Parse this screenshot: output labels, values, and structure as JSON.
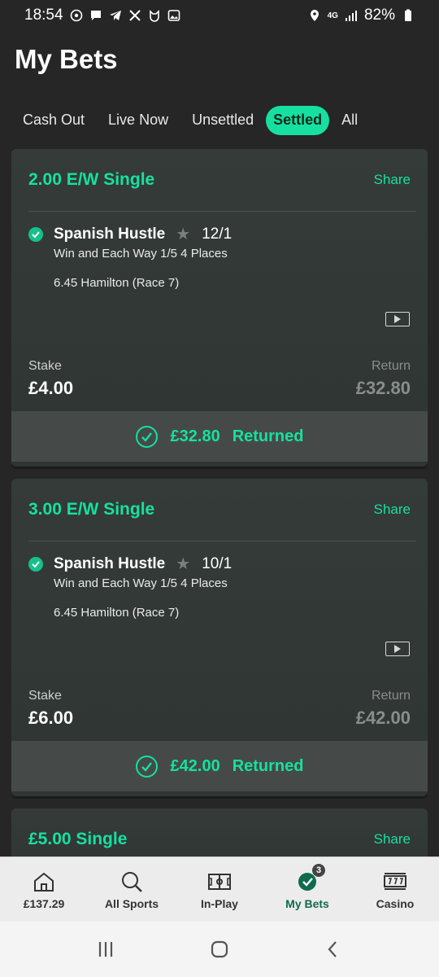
{
  "status_bar": {
    "time": "18:54",
    "network": "4G",
    "battery": "82%"
  },
  "page_title": "My Bets",
  "tabs": [
    {
      "label": "Cash Out",
      "active": false
    },
    {
      "label": "Live Now",
      "active": false
    },
    {
      "label": "Unsettled",
      "active": false
    },
    {
      "label": "Settled",
      "active": true
    },
    {
      "label": "All",
      "active": false
    }
  ],
  "bets": [
    {
      "bet_type": "2.00 E/W Single",
      "share_label": "Share",
      "selection_name": "Spanish Hustle",
      "odds": "12/1",
      "market": "Win and Each Way 1/5 4 Places",
      "event": "6.45 Hamilton (Race 7)",
      "stake_label": "Stake",
      "stake": "£4.00",
      "return_label": "Return",
      "return": "£32.80",
      "returned_amount": "£32.80",
      "returned_label": "Returned"
    },
    {
      "bet_type": "3.00 E/W Single",
      "share_label": "Share",
      "selection_name": "Spanish Hustle",
      "odds": "10/1",
      "market": "Win and Each Way 1/5 4 Places",
      "event": "6.45 Hamilton (Race 7)",
      "stake_label": "Stake",
      "stake": "£6.00",
      "return_label": "Return",
      "return": "£42.00",
      "returned_amount": "£42.00",
      "returned_label": "Returned"
    },
    {
      "bet_type": "£5.00 Single",
      "share_label": "Share"
    }
  ],
  "bottom_nav": [
    {
      "label": "£137.29",
      "icon": "home-icon",
      "active": false
    },
    {
      "label": "All Sports",
      "icon": "search-icon",
      "active": false
    },
    {
      "label": "In-Play",
      "icon": "pitch-icon",
      "active": false
    },
    {
      "label": "My Bets",
      "icon": "check-circle-icon",
      "active": true,
      "badge": "3"
    },
    {
      "label": "Casino",
      "icon": "slot-machine-icon",
      "active": false
    }
  ],
  "colors": {
    "accent": "#16e0a0",
    "background": "#262626",
    "card": "#353b39",
    "nav_active": "#0f6b4d"
  }
}
